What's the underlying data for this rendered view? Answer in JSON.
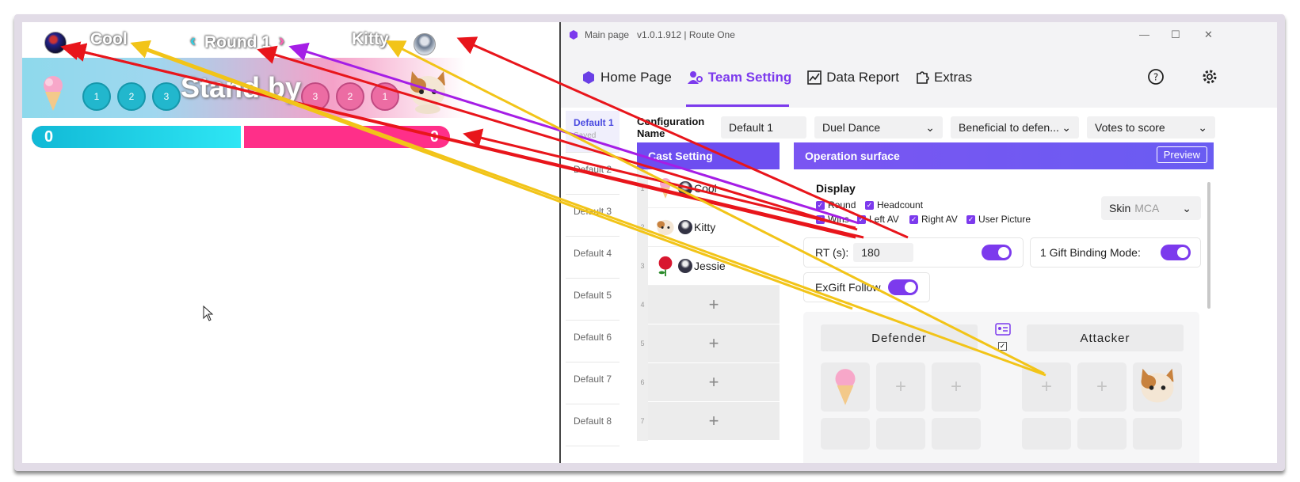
{
  "overlay": {
    "left_name": "Cool",
    "round_label": "Round 1",
    "right_name": "Kitty",
    "chev_left": "‹",
    "chev_right": "›",
    "standby": "Stand by",
    "left_slots": [
      "1",
      "2",
      "3"
    ],
    "right_slots": [
      "3",
      "2",
      "1"
    ],
    "left_score": "0",
    "right_score": "0",
    "left_progress": 0.5
  },
  "window": {
    "title": "Main page   v1.0.1.912 | Route One",
    "controls": {
      "minimize": "—",
      "maximize": "☐",
      "close": "✕"
    }
  },
  "nav": {
    "items": [
      {
        "label": "Home Page",
        "icon": "hexagon-icon"
      },
      {
        "label": "Team Setting",
        "icon": "team-icon"
      },
      {
        "label": "Data Report",
        "icon": "chart-icon"
      },
      {
        "label": "Extras",
        "icon": "puzzle-icon"
      }
    ],
    "active": "Team Setting"
  },
  "defaults": {
    "items": [
      "Default 1",
      "Default 2",
      "Default 3",
      "Default 4",
      "Default 5",
      "Default 6",
      "Default 7",
      "Default 8"
    ],
    "saved": "Saved"
  },
  "config": {
    "label": "Configuration Name",
    "name_value": "Default 1",
    "mode": "Duel Dance",
    "benefit": "Beneficial to defen...",
    "scoring": "Votes to score"
  },
  "cast": {
    "header": "Cast Setting",
    "members": [
      {
        "num": "1",
        "name": "Cool"
      },
      {
        "num": "2",
        "name": "Kitty"
      },
      {
        "num": "3",
        "name": "Jessie"
      }
    ],
    "empty_rows": [
      "4",
      "5",
      "6",
      "7"
    ],
    "add_symbol": "+"
  },
  "operation": {
    "header": "Operation surface",
    "preview": "Preview",
    "display_title": "Display",
    "checkboxes_row1": [
      "Round",
      "Headcount"
    ],
    "checkboxes_row2": [
      "Wins",
      "Left AV",
      "Right AV",
      "User Picture"
    ],
    "skin_label": "Skin",
    "skin_value": "MCA",
    "rt_label": "RT (s):",
    "rt_value": "180",
    "gift_binding": "1 Gift Binding Mode:",
    "exgift": "ExGift Follow",
    "defender": "Defender",
    "attacker": "Attacker",
    "plus": "+"
  },
  "colors": {
    "accent": "#7c3aed",
    "annotation_red": "#e8151b",
    "annotation_yellow": "#f2c418",
    "annotation_purple": "#a51ee6",
    "cyan": "#22b7cd",
    "pink": "#ff2f89"
  }
}
